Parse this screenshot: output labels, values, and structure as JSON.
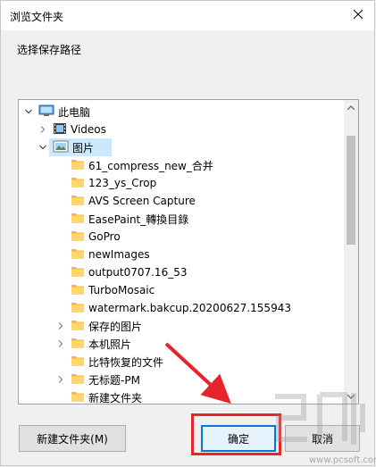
{
  "window": {
    "title": "浏览文件夹",
    "close_icon": "close-icon"
  },
  "prompt": "选择保存路径",
  "tree": {
    "items": [
      {
        "label": "此电脑",
        "icon": "computer-icon",
        "expander": "expanded",
        "indent": 0
      },
      {
        "label": "Videos",
        "icon": "video-folder-icon",
        "expander": "collapsed",
        "indent": 1
      },
      {
        "label": "图片",
        "icon": "pictures-folder-icon",
        "expander": "expanded",
        "indent": 1,
        "selected": true
      },
      {
        "label": "61_compress_new_合并",
        "icon": "folder-icon",
        "expander": "none",
        "indent": 2
      },
      {
        "label": "123_ys_Crop",
        "icon": "folder-icon",
        "expander": "none",
        "indent": 2
      },
      {
        "label": "AVS Screen Capture",
        "icon": "folder-icon",
        "expander": "none",
        "indent": 2
      },
      {
        "label": "EasePaint_轉換目錄",
        "icon": "folder-icon",
        "expander": "none",
        "indent": 2
      },
      {
        "label": "GoPro",
        "icon": "folder-icon",
        "expander": "none",
        "indent": 2
      },
      {
        "label": "newImages",
        "icon": "folder-icon",
        "expander": "none",
        "indent": 2
      },
      {
        "label": "output0707.16_53",
        "icon": "folder-icon",
        "expander": "none",
        "indent": 2
      },
      {
        "label": "TurboMosaic",
        "icon": "folder-icon",
        "expander": "none",
        "indent": 2
      },
      {
        "label": "watermark.bakcup.20200627.155943",
        "icon": "folder-icon",
        "expander": "none",
        "indent": 2
      },
      {
        "label": "保存的图片",
        "icon": "folder-icon",
        "expander": "collapsed",
        "indent": 2
      },
      {
        "label": "本机照片",
        "icon": "folder-icon",
        "expander": "collapsed",
        "indent": 2
      },
      {
        "label": "比特恢复的文件",
        "icon": "folder-icon",
        "expander": "none",
        "indent": 2
      },
      {
        "label": "无标题-PM",
        "icon": "folder-icon",
        "expander": "collapsed",
        "indent": 2
      },
      {
        "label": "新建文件夹",
        "icon": "folder-icon",
        "expander": "none",
        "indent": 2
      }
    ]
  },
  "buttons": {
    "new_folder": "新建文件夹(M)",
    "ok": "确定",
    "cancel": "取消"
  },
  "watermark": {
    "text": "www.pcsoft.com"
  },
  "colors": {
    "selection": "#cce8ff",
    "folder": "#ffd86b",
    "annotation": "#e6242a",
    "focus": "#0078d7"
  }
}
